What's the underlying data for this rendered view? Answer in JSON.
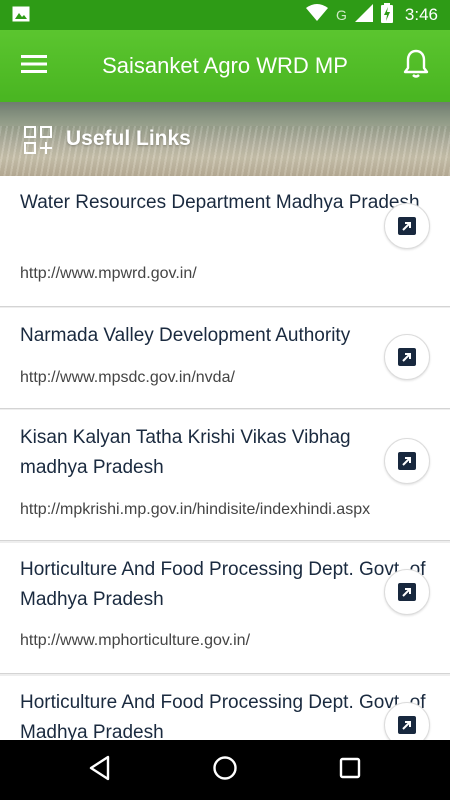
{
  "status_bar": {
    "time": "3:46",
    "network_label": "G",
    "icons": [
      "image-notification-icon",
      "wifi-icon",
      "signal-icon",
      "battery-charging-icon"
    ]
  },
  "app_bar": {
    "title": "Saisanket Agro WRD MP",
    "menu_icon": "hamburger-menu-icon",
    "notification_icon": "bell-icon",
    "background_color": "#4fbb26"
  },
  "banner": {
    "title": "Useful Links",
    "icon": "grid-add-icon"
  },
  "links": [
    {
      "name": "Water Resources Department Madhya Pradesh",
      "url": "http://www.mpwrd.gov.in/",
      "icon": "open-link-icon"
    },
    {
      "name": "Narmada Valley Development Authority",
      "url": "http://www.mpsdc.gov.in/nvda/",
      "icon": "open-link-icon"
    },
    {
      "name": "Kisan Kalyan Tatha Krishi Vikas Vibhag madhya Pradesh",
      "url": "http://mpkrishi.mp.gov.in/hindisite/indexhindi.aspx",
      "icon": "open-link-icon"
    },
    {
      "name": "Horticulture And Food Processing Dept. Govt. of Madhya Pradesh",
      "url": "http://www.mphorticulture.gov.in/",
      "icon": "open-link-icon"
    },
    {
      "name": "Horticulture And Food Processing Dept. Govt. of Madhya Pradesh",
      "url": "",
      "icon": "open-link-icon"
    }
  ],
  "nav_bar": {
    "icons": [
      "back-icon",
      "home-icon",
      "recents-icon"
    ]
  }
}
